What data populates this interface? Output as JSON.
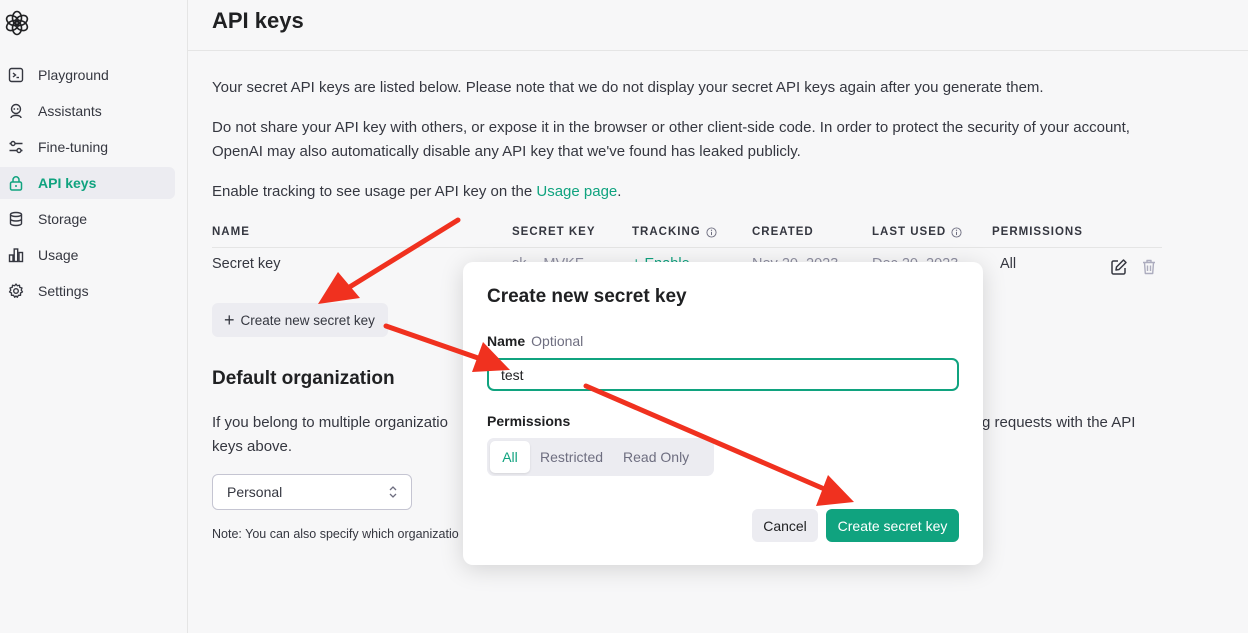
{
  "colors": {
    "accent": "#10a37f",
    "arrow": "#f0311f"
  },
  "sidebar": {
    "logo_icon": "openai-logo-icon",
    "items": [
      {
        "label": "Playground",
        "icon": "terminal-icon"
      },
      {
        "label": "Assistants",
        "icon": "robot-icon"
      },
      {
        "label": "Fine-tuning",
        "icon": "sliders-icon"
      },
      {
        "label": "API keys",
        "icon": "lock-icon",
        "active": true
      },
      {
        "label": "Storage",
        "icon": "database-icon"
      },
      {
        "label": "Usage",
        "icon": "bar-chart-icon"
      },
      {
        "label": "Settings",
        "icon": "gear-icon"
      }
    ]
  },
  "page": {
    "title": "API keys",
    "intro": "Your secret API keys are listed below. Please note that we do not display your secret API keys again after you generate them.",
    "warning": "Do not share your API key with others, or expose it in the browser or other client-side code. In order to protect the security of your account, OpenAI may also automatically disable any API key that we've found has leaked publicly.",
    "tracking_prefix": "Enable tracking to see usage per API key on the ",
    "tracking_link": "Usage page",
    "tracking_suffix": "."
  },
  "table": {
    "headers": {
      "name": "NAME",
      "secret_key": "SECRET KEY",
      "tracking": "TRACKING",
      "created": "CREATED",
      "last_used": "LAST USED",
      "permissions": "PERMISSIONS"
    },
    "rows": [
      {
        "name": "Secret key",
        "secret_key": "sk-...MVKF",
        "tracking": "+ Enable",
        "created": "Nov 20, 2023",
        "last_used": "Dec 20, 2023",
        "permissions": "All"
      }
    ]
  },
  "create_button": {
    "label": "Create new secret key"
  },
  "default_org": {
    "title": "Default organization",
    "description_start": "If you belong to multiple organizatio",
    "description_end": "g requests with the API",
    "description_line2": "keys above.",
    "selected": "Personal",
    "note": "Note: You can also specify which organizatio"
  },
  "modal": {
    "title": "Create new secret key",
    "name_label": "Name",
    "name_hint": "Optional",
    "name_value": "test",
    "permissions_label": "Permissions",
    "permission_options": [
      "All",
      "Restricted",
      "Read Only"
    ],
    "selected_permission": "All",
    "cancel_label": "Cancel",
    "submit_label": "Create secret key"
  }
}
